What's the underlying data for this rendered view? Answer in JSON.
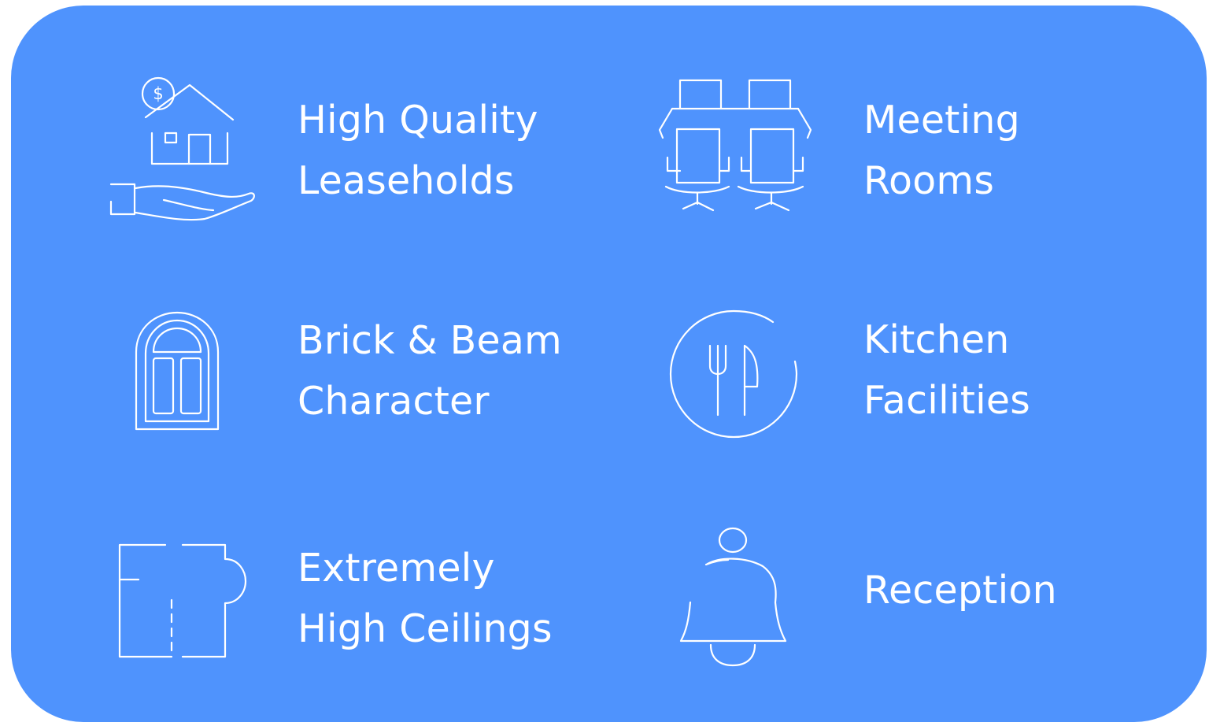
{
  "features": [
    {
      "icon": "house-in-hand-dollar-icon",
      "lines": [
        "High Quality",
        "Leaseholds"
      ]
    },
    {
      "icon": "meeting-table-chairs-icon",
      "lines": [
        "Meeting",
        "Rooms"
      ]
    },
    {
      "icon": "arched-window-door-icon",
      "lines": [
        "Brick & Beam",
        "Character"
      ]
    },
    {
      "icon": "fork-knife-plate-icon",
      "lines": [
        "Kitchen",
        "Facilities"
      ]
    },
    {
      "icon": "floor-plan-icon",
      "lines": [
        "Extremely",
        "High Ceilings"
      ]
    },
    {
      "icon": "reception-bell-icon",
      "lines": [
        "Reception"
      ]
    }
  ],
  "colors": {
    "panel": "#4f93fd",
    "foreground": "#ffffff"
  }
}
